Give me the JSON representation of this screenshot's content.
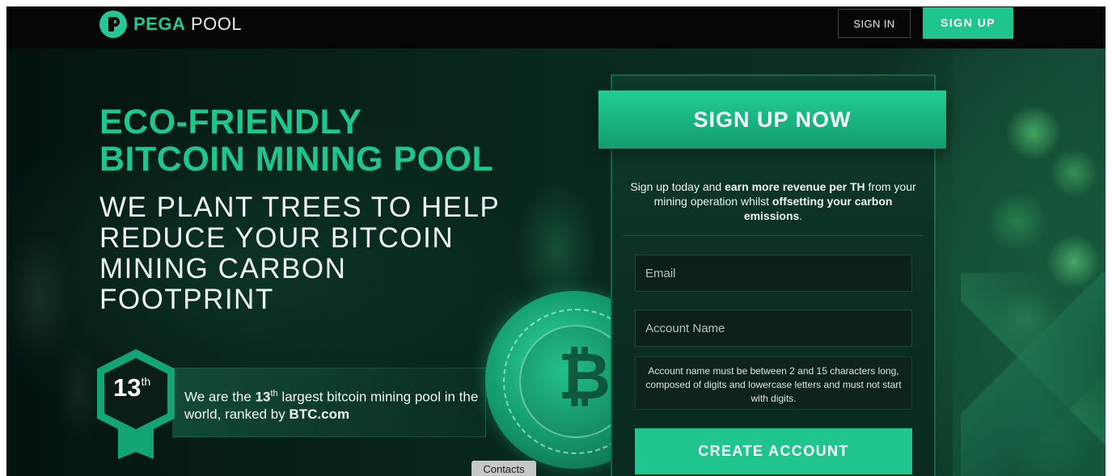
{
  "brand": {
    "name_part1": "PEGA",
    "name_part2": "POOL",
    "accent": "#1fc48f",
    "logo_icon": "pega-logo-icon"
  },
  "nav": {
    "signin_label": "SIGN IN",
    "signup_label": "SIGN UP"
  },
  "hero": {
    "headline_line1": "ECO-FRIENDLY",
    "headline_line2": "BITCOIN MINING POOL",
    "subheadline": [
      "WE PLANT TREES TO HELP",
      "REDUCE YOUR BITCOIN",
      "MINING CARBON",
      "FOOTPRINT"
    ]
  },
  "rank": {
    "badge_number": "13",
    "badge_suffix": "th",
    "text_before": "We are the ",
    "text_number": "13",
    "text_suffix": "th",
    "text_after": " largest bitcoin mining pool in the world, ranked by ",
    "ranker": "BTC.com"
  },
  "coin": {
    "icon": "bitcoin-coin-icon"
  },
  "contacts": {
    "label": "Contacts"
  },
  "signup_panel": {
    "title": "SIGN UP NOW",
    "desc_1": "Sign up today and ",
    "desc_bold_1": "earn more revenue per TH",
    "desc_2": " from your mining operation whilst ",
    "desc_bold_2": "offsetting your carbon emissions",
    "desc_3": ".",
    "email_placeholder": "Email",
    "account_placeholder": "Account Name",
    "hint": "Account name must be between 2 and 15 characters long, composed of digits and lowercase letters and must not start with digits.",
    "create_label": "CREATE ACCOUNT"
  }
}
